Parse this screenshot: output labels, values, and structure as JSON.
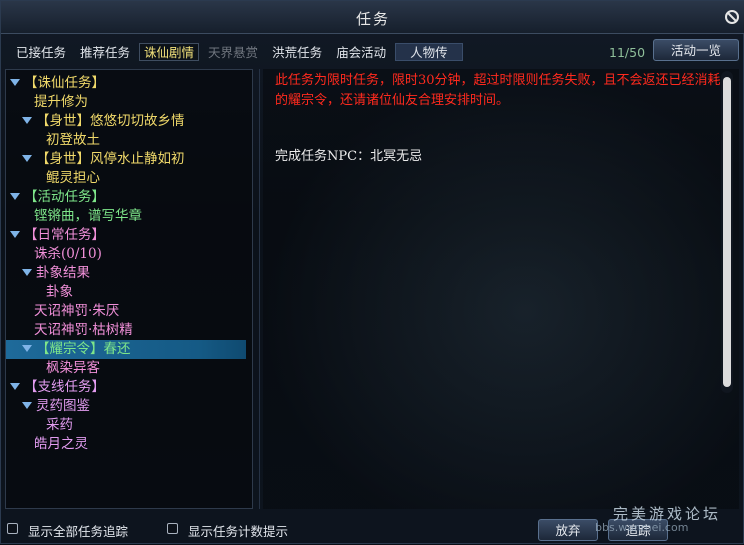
{
  "window": {
    "title": "任务"
  },
  "tabs": [
    {
      "label": "已接任务",
      "state": "normal"
    },
    {
      "label": "推荐任务",
      "state": "normal"
    },
    {
      "label": "诛仙剧情",
      "state": "active"
    },
    {
      "label": "天界悬赏",
      "state": "dim"
    },
    {
      "label": "洪荒任务",
      "state": "normal"
    },
    {
      "label": "庙会活动",
      "state": "normal"
    },
    {
      "label": "人物传",
      "state": "boxed"
    }
  ],
  "counter": "11/50",
  "activity_button": "活动一览",
  "tree": [
    {
      "text": "【诛仙任务】",
      "color": "#f0d96a",
      "arrow": true
    },
    {
      "text": "提升修为",
      "color": "#f0d96a",
      "arrow": false
    },
    {
      "text": "【身世】悠悠切切故乡情",
      "color": "#f0d96a",
      "arrow": true
    },
    {
      "text": "初登故土",
      "color": "#f0d96a",
      "arrow": false
    },
    {
      "text": "【身世】风停水止静如初",
      "color": "#f0d96a",
      "arrow": true
    },
    {
      "text": "鲲灵担心",
      "color": "#f0d96a",
      "arrow": false
    },
    {
      "text": "【活动任务】",
      "color": "#7ee68a",
      "arrow": true
    },
    {
      "text": "铿锵曲，谱写华章",
      "color": "#7ee68a",
      "arrow": false
    },
    {
      "text": "【日常任务】",
      "color": "#f08fd8",
      "arrow": true
    },
    {
      "text": "诛杀(0/10)",
      "color": "#f08fd8",
      "arrow": false
    },
    {
      "text": "卦象结果",
      "color": "#f08fd8",
      "arrow": true
    },
    {
      "text": "卦象",
      "color": "#f08fd8",
      "arrow": false
    },
    {
      "text": "天诏神罚·朱厌",
      "color": "#f08fd8",
      "arrow": false
    },
    {
      "text": "天诏神罚·枯树精",
      "color": "#f08fd8",
      "arrow": false
    },
    {
      "text": "【耀宗令】春还",
      "color": "#7ee68a",
      "arrow": true,
      "selected": true
    },
    {
      "text": "枫染异客",
      "color": "#f08fd8",
      "arrow": false
    },
    {
      "text": "【支线任务】",
      "color": "#e29cf0",
      "arrow": true
    },
    {
      "text": "灵药图鉴",
      "color": "#e29cf0",
      "arrow": true
    },
    {
      "text": "采药",
      "color": "#e29cf0",
      "arrow": false
    },
    {
      "text": "皓月之灵",
      "color": "#e29cf0",
      "arrow": false
    }
  ],
  "detail": {
    "warning": "此任务为限时任务，限时30分钟，超过时限则任务失败，且不会返还已经消耗的耀宗令，还请诸位仙友合理安排时间。",
    "npc": "完成任务NPC：北冥无忌"
  },
  "bottom": {
    "show_all_tracking": "显示全部任务追踪",
    "show_counter_tip": "显示任务计数提示",
    "abandon": "放弃",
    "track": "追踪"
  },
  "watermark": "完美游戏论坛",
  "watermark_url": "bbs.wanmei.com"
}
